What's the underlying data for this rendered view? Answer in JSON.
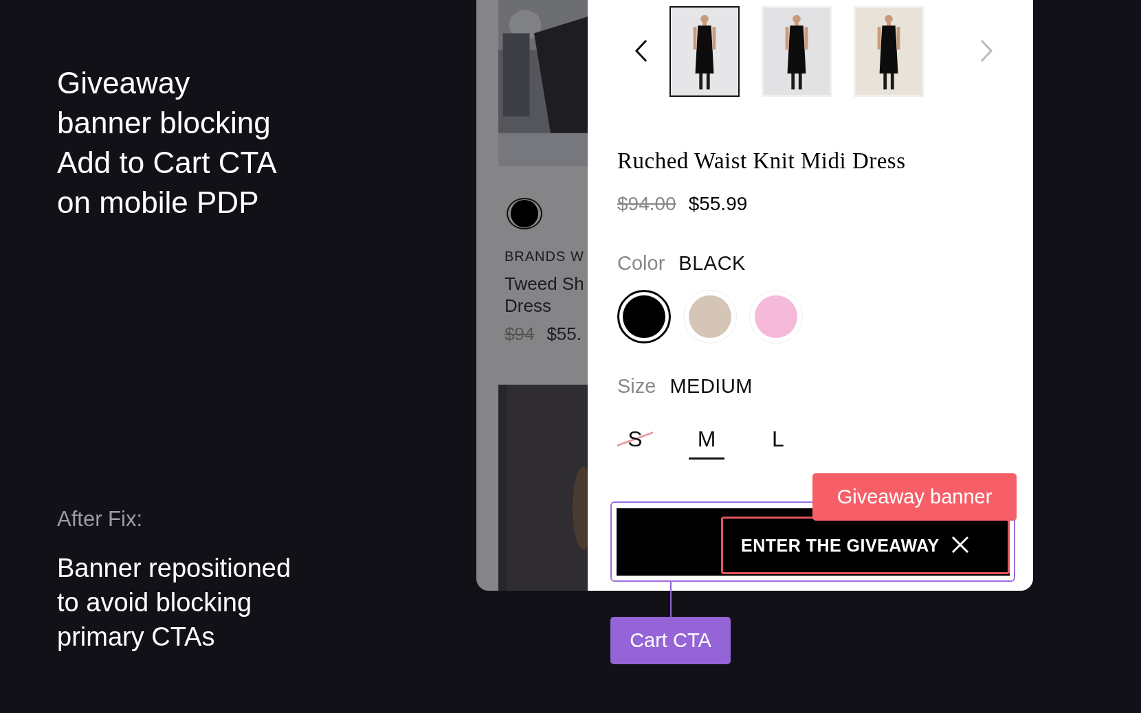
{
  "notes": {
    "title": "Giveaway\nbanner blocking\nAdd to Cart CTA\non mobile PDP",
    "after_label": "After Fix:",
    "after_text": "Banner repositioned\nto avoid blocking\nprimary CTAs"
  },
  "listing": {
    "brand": "BRANDS W",
    "name_lines": [
      "Tweed Sh",
      "Dress"
    ],
    "old_price": "$94",
    "price": "$55."
  },
  "product": {
    "thumbnails": [
      {
        "kind": "picture",
        "selected": true
      },
      {
        "kind": "picture",
        "selected": false
      },
      {
        "kind": "picture",
        "selected": false
      }
    ],
    "title": "Ruched Waist Knit Midi Dress",
    "old_price": "$94.00",
    "price": "$55.99",
    "color_label": "Color",
    "color_value": "BLACK",
    "swatches": [
      {
        "color": "#000000",
        "selected": true
      },
      {
        "color": "#d4c5b6",
        "selected": false
      },
      {
        "color": "#f5b9da",
        "selected": false
      }
    ],
    "size_label": "Size",
    "size_value": "MEDIUM",
    "sizes": [
      {
        "label": "S",
        "selected": false,
        "disabled": true
      },
      {
        "label": "M",
        "selected": true,
        "disabled": false
      },
      {
        "label": "L",
        "selected": false,
        "disabled": false
      }
    ]
  },
  "banner": {
    "text": "ENTER THE GIVEAWAY"
  },
  "annotations": [
    {
      "label": "Giveaway banner",
      "color": "#f65f68"
    },
    {
      "label": "Cart CTA",
      "color": "#9564d6"
    }
  ]
}
